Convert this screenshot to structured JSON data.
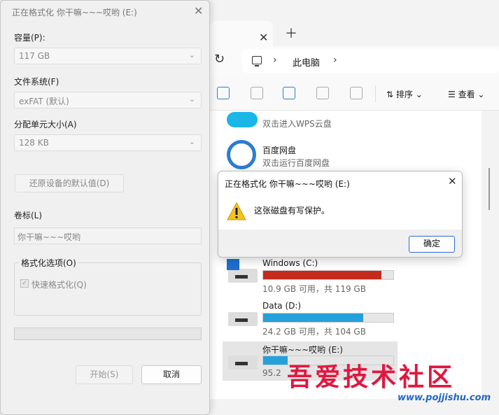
{
  "format_dialog": {
    "title": "正在格式化 你干嘛~~~哎哟 (E:)",
    "capacity_label": "容量(P):",
    "capacity_value": "117 GB",
    "filesystem_label": "文件系统(F)",
    "filesystem_value": "exFAT (默认)",
    "allocation_label": "分配单元大小(A)",
    "allocation_value": "128 KB",
    "restore_label": "还原设备的默认值(D)",
    "volume_label_label": "卷标(L)",
    "volume_label_value": "你干嘛~~~哎哟",
    "options_group_label": "格式化选项(O)",
    "quick_format_label": "快速格式化(Q)",
    "quick_format_checked": true,
    "progress_fraction": 0,
    "start_label": "开始(S)",
    "cancel_label": "取消"
  },
  "message_box": {
    "title": "正在格式化 你干嘛~~~哎哟 (E:)",
    "text": "这张磁盘有写保护。",
    "ok_label": "确定",
    "icon": "warning-icon"
  },
  "explorer": {
    "breadcrumb": "此电脑",
    "sort_label": "排序",
    "view_label": "查看",
    "items": [
      {
        "name": "",
        "sub": "双击进入WPS云盘",
        "icon": "wps-cloud-icon"
      },
      {
        "name": "百度网盘",
        "sub": "双击运行百度网盘",
        "icon": "baidu-netdisk-icon"
      }
    ],
    "drives": [
      {
        "name": "Windows (C:)",
        "free": "10.9 GB 可用，共 119 GB",
        "used_fraction": 0.91,
        "color": "#c42b1c"
      },
      {
        "name": "Data (D:)",
        "free": "24.2 GB 可用，共 104 GB",
        "used_fraction": 0.77,
        "color": "#26a0da"
      },
      {
        "name": "你干嘛~~~哎哟 (E:)",
        "free": "95.2",
        "used_fraction": 0.19,
        "color": "#26a0da"
      }
    ]
  },
  "watermark": {
    "text": "吾爱技术社区",
    "url": "www.pojjishu.com"
  }
}
